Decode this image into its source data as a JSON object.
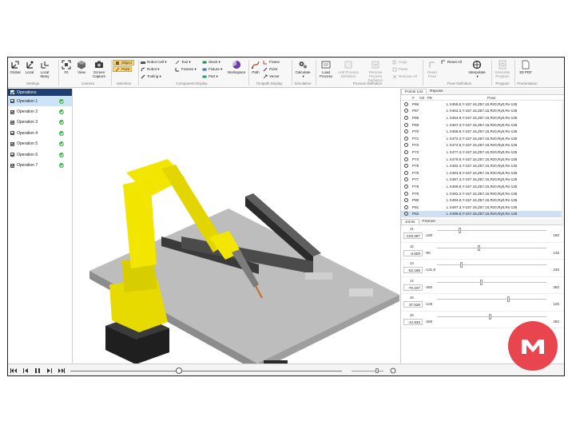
{
  "ribbon": {
    "buttons": [
      {
        "label": "Global",
        "icon": "global-frame-icon"
      },
      {
        "label": "Local",
        "icon": "local-frame-icon"
      },
      {
        "label": "Local Many",
        "icon": "local-many-icon"
      },
      {
        "label": "Fit",
        "icon": "fit-icon"
      },
      {
        "label": "View",
        "icon": "view-cube-icon"
      },
      {
        "label": "Screen Capture",
        "icon": "camera-icon"
      },
      {
        "label": "Workspace",
        "icon": "workspace-icon"
      },
      {
        "label": "Calculate",
        "icon": "gear-icon"
      },
      {
        "label": "Load Process",
        "icon": "load-process-icon"
      },
      {
        "label": "Add Process Definition",
        "icon": "add-process-icon"
      },
      {
        "label": "Remove Process Definition",
        "icon": "remove-process-icon"
      },
      {
        "label": "Reset Pose",
        "icon": "reset-pose-icon"
      },
      {
        "label": "Interpolate",
        "icon": "interpolate-icon"
      },
      {
        "label": "Generate Program",
        "icon": "generate-program-icon"
      },
      {
        "label": "3D PDF",
        "icon": "pdf-icon"
      }
    ],
    "small": {
      "object": "Object",
      "point": "Point",
      "robot_cell": "Robot Cell",
      "robot": "Robot",
      "tooling": "Tooling",
      "tool": "Tool",
      "frames": "Frames",
      "stock": "Stock",
      "fixture": "Fixture",
      "part": "Part",
      "path": "Path",
      "frame": "Frame",
      "point2": "Point",
      "vector": "Vector",
      "copy": "Copy",
      "paste": "Paste",
      "remove_all": "Remove All",
      "reset_all": "Reset All"
    },
    "groups": {
      "settings": "Settings",
      "camera": "Camera",
      "selection": "Selection",
      "component_display": "Component Display",
      "toolpath_display": "Toolpath Display",
      "simulation": "Simulation",
      "process_definition": "Process Definition",
      "pose_definition": "Pose Definition",
      "program": "Program",
      "presentation": "Presentation"
    }
  },
  "operations": {
    "header": "Operations",
    "items": [
      "Operation 1",
      "Operation 2",
      "Operation 3",
      "Operation 4",
      "Operation 5",
      "Operation 6",
      "Operation 7"
    ],
    "selected_index": 0
  },
  "points_panel": {
    "tabs": [
      "Points List",
      "Repose"
    ],
    "columns": [
      "#",
      "CE",
      "PE",
      "Pose"
    ],
    "rows": [
      {
        "name": "P66",
        "pose": "L X459.8,Y-157.16,Z57.15,Rz0,Ry0,Rx-135"
      },
      {
        "name": "P67",
        "pose": "L X462.3,Y-157.16,Z57.15,Rz0,Ry0,Rx-135"
      },
      {
        "name": "P68",
        "pose": "L X464.8,Y-157.16,Z57.15,Rz0,Ry0,Rx-135"
      },
      {
        "name": "P69",
        "pose": "L X467.3,Y-157.16,Z57.15,Rz0,Ry0,Rx-135"
      },
      {
        "name": "P70",
        "pose": "L X469.8,Y-157.16,Z57.15,Rz0,Ry0,Rx-135"
      },
      {
        "name": "P71",
        "pose": "L X472.3,Y-157.16,Z57.15,Rz0,Ry0,Rx-135"
      },
      {
        "name": "P72",
        "pose": "L X474.8,Y-157.16,Z57.15,Rz0,Ry0,Rx-135"
      },
      {
        "name": "P73",
        "pose": "L X477.3,Y-157.16,Z57.15,Rz0,Ry0,Rx-135"
      },
      {
        "name": "P74",
        "pose": "L X479.8,Y-157.16,Z57.15,Rz0,Ry0,Rx-135"
      },
      {
        "name": "P75",
        "pose": "L X482.3,Y-157.16,Z57.15,Rz0,Ry0,Rx-135"
      },
      {
        "name": "P76",
        "pose": "L X484.8,Y-157.16,Z57.15,Rz0,Ry0,Rx-135"
      },
      {
        "name": "P77",
        "pose": "L X487.3,Y-157.16,Z57.15,Rz0,Ry0,Rx-135"
      },
      {
        "name": "P78",
        "pose": "L X489.8,Y-157.16,Z57.15,Rz0,Ry0,Rx-135"
      },
      {
        "name": "P79",
        "pose": "L X492.3,Y-157.16,Z57.15,Rz0,Ry0,Rx-135"
      },
      {
        "name": "P80",
        "pose": "L X494.8,Y-157.16,Z57.15,Rz0,Ry0,Rx-135"
      },
      {
        "name": "P81",
        "pose": "L X497.3,Y-157.16,Z57.15,Rz0,Ry0,Rx-135"
      },
      {
        "name": "P82",
        "pose": "L X499.8,Y-157.16,Z57.15,Rz0,Ry0,Rx-135"
      }
    ],
    "selected_index": 16
  },
  "joints_panel": {
    "tabs": [
      "Joints",
      "Frames"
    ],
    "joints": [
      {
        "name": "J1",
        "value": "-103.287",
        "min": "-180",
        "max": "180",
        "fraction": 0.21
      },
      {
        "name": "J2",
        "value": "-3.500",
        "min": "-90",
        "max": "135",
        "fraction": 0.38
      },
      {
        "name": "J3",
        "value": "-52.165",
        "min": "-131.8",
        "max": "230",
        "fraction": 0.22
      },
      {
        "name": "J4",
        "value": "-70.237",
        "min": "-360",
        "max": "360",
        "fraction": 0.4
      },
      {
        "name": "J5",
        "value": "37.528",
        "min": "-125",
        "max": "125",
        "fraction": 0.65
      },
      {
        "name": "J6",
        "value": "-12.933",
        "min": "-360",
        "max": "360",
        "fraction": 0.48
      }
    ]
  },
  "playback": {
    "progress": 0.4,
    "speed": 0.8
  },
  "colors": {
    "robot_yellow": "#f2e600",
    "ops_header": "#1e3f74",
    "selection": "#cde3f7",
    "ok_green": "#3fb34f",
    "logo_red": "#e8454f"
  }
}
